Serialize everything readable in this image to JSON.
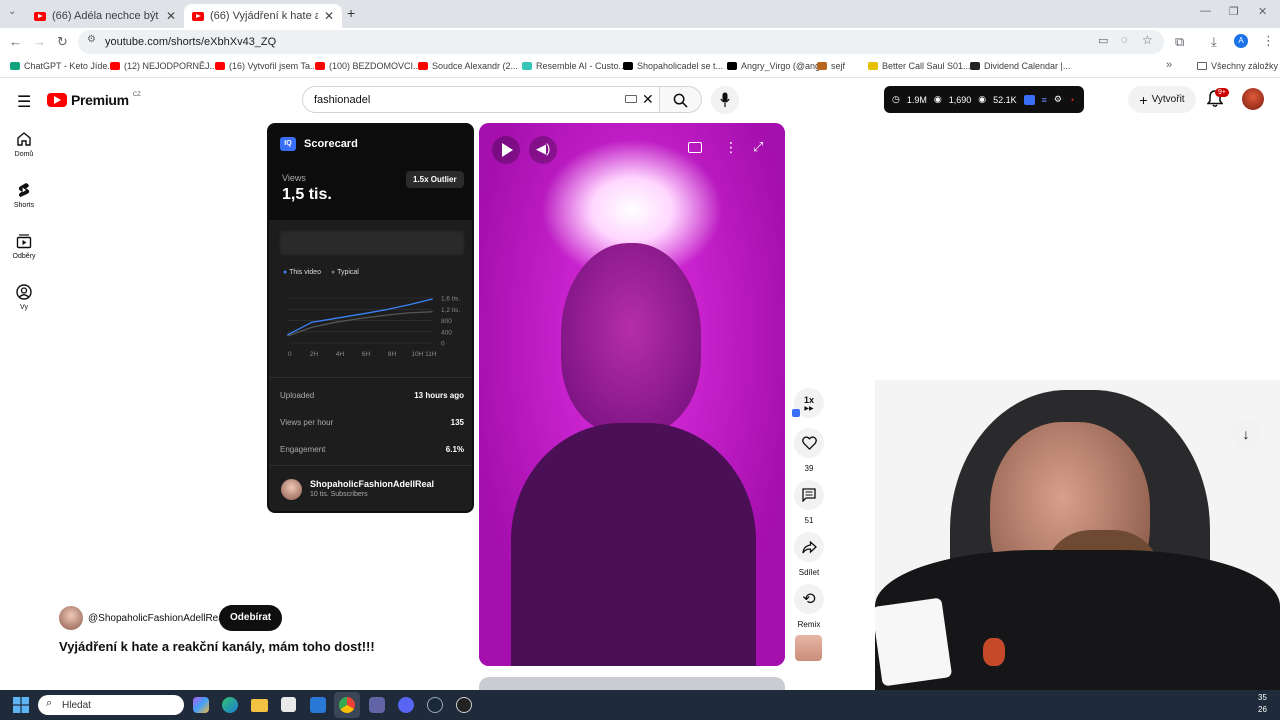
{
  "browser": {
    "tabs": [
      {
        "title": "(66) Adéla nechce být jak Vlad..."
      },
      {
        "title": "(66) Vyjádření k hate a reakční k..."
      }
    ],
    "new_tab_label": "+",
    "url": "youtube.com/shorts/eXbhXv43_ZQ",
    "bookmarks": [
      {
        "label": "ChatGPT - Keto Jíde...",
        "color": "#10a37f"
      },
      {
        "label": "(12) NEJODPORNĚJ...",
        "color": "#ff0000"
      },
      {
        "label": "(16) Vytvořil jsem Ta...",
        "color": "#ff0000"
      },
      {
        "label": "(100) BEZDOMOVCI...",
        "color": "#ff0000"
      },
      {
        "label": "Soudce Alexandr (2...",
        "color": "#ff0000"
      },
      {
        "label": "Resemble AI - Custo...",
        "color": "#36c5b6"
      },
      {
        "label": "Shopaholicadel se t...",
        "color": "#000000"
      },
      {
        "label": "Angry_Virgo (@ang...",
        "color": "#000000"
      },
      {
        "label": "sejf",
        "color": "#b5651d"
      },
      {
        "label": "Better Call Saul S01...",
        "color": "#e5c100"
      },
      {
        "label": "Dividend Calendar |...",
        "color": "#222222"
      }
    ],
    "all_bookmarks_label": "Všechny záložky",
    "profile_letter": "A"
  },
  "youtube": {
    "logo_text": "Premium",
    "logo_region": "CZ",
    "search_value": "fashionadel",
    "sidebar": [
      {
        "label": "Domů",
        "icon": "home-icon"
      },
      {
        "label": "Shorts",
        "icon": "shorts-icon"
      },
      {
        "label": "Odběry",
        "icon": "subscriptions-icon"
      },
      {
        "label": "Vy",
        "icon": "you-icon"
      }
    ],
    "stats": {
      "subs": "1.9M",
      "views": "1,690",
      "views2": "52.1K"
    },
    "create_label": "Vytvořit",
    "notifications_badge": "9+"
  },
  "scorecard": {
    "title": "Scorecard",
    "views_label": "Views",
    "views_value": "1,5 tis.",
    "outlier_badge": "1.5x Outlier",
    "legend_this": "This video",
    "legend_typical": "Typical",
    "uploaded_label": "Uploaded",
    "uploaded_value": "13 hours ago",
    "vph_label": "Views per hour",
    "vph_value": "135",
    "engagement_label": "Engagement",
    "engagement_value": "6.1%",
    "channel_name": "ShopaholicFashionAdellReal",
    "channel_subs": "10 tis. Subscribers"
  },
  "chart_data": {
    "type": "line",
    "x": [
      "0",
      "2H",
      "4H",
      "6H",
      "8H",
      "10H",
      "11H"
    ],
    "xtick_labels": [
      "0",
      "2H",
      "4H",
      "6H",
      "8H",
      "10H 11H"
    ],
    "ytick_labels": [
      "1,6 tis.",
      "1,2 tis.",
      "800",
      "400",
      "0"
    ],
    "ylim": [
      0,
      1600
    ],
    "series": [
      {
        "name": "This video",
        "values": [
          300,
          740,
          880,
          1020,
          1170,
          1350,
          1560
        ],
        "color": "#3b82f6"
      },
      {
        "name": "Typical",
        "values": [
          260,
          560,
          740,
          870,
          980,
          1070,
          1110
        ],
        "color": "#555555"
      }
    ]
  },
  "video_actions": {
    "speed_label": "1x",
    "likes": "39",
    "comments": "51",
    "share_label": "Sdílet",
    "remix_label": "Remix"
  },
  "video": {
    "channel_handle": "@ShopaholicFashionAdellReal",
    "subscribe_label": "Odebírat",
    "title": "Vyjádření k hate a reakční kanály, mám toho dost!!!"
  },
  "taskbar": {
    "search_placeholder": "Hledat",
    "clock_line1": "35",
    "clock_line2": "26"
  }
}
